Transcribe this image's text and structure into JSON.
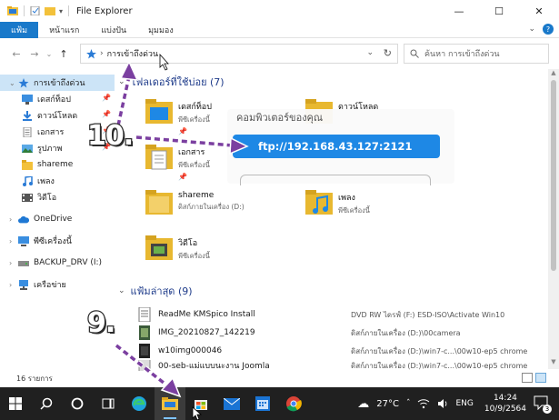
{
  "window": {
    "title": "File Explorer",
    "controls": {
      "minimize": "—",
      "maximize": "☐",
      "close": "✕"
    }
  },
  "ribbon": {
    "tabs": [
      "แฟ้ม",
      "หน้าแรก",
      "แบ่งปัน",
      "มุมมอง"
    ],
    "expand": "⌄",
    "help": "?"
  },
  "address": {
    "back": "←",
    "forward": "→",
    "recent": "⌄",
    "up": "↑",
    "sep": "›",
    "location": "การเข้าถึงด่วน",
    "dropdown": "⌄",
    "refresh": "↻"
  },
  "search": {
    "placeholder": "ค้นหา การเข้าถึงด่วน"
  },
  "sidebar": {
    "quick": "การเข้าถึงด่วน",
    "items": [
      {
        "label": "เดสก์ท็อป",
        "icon": "desktop-icon",
        "pinned": true
      },
      {
        "label": "ดาวน์โหลด",
        "icon": "download-icon",
        "pinned": true
      },
      {
        "label": "เอกสาร",
        "icon": "document-icon",
        "pinned": true
      },
      {
        "label": "รูปภาพ",
        "icon": "picture-icon",
        "pinned": true
      },
      {
        "label": "shareme",
        "icon": "folder-icon",
        "pinned": false
      },
      {
        "label": "เพลง",
        "icon": "music-icon",
        "pinned": false
      },
      {
        "label": "วิดีโอ",
        "icon": "video-icon",
        "pinned": false
      }
    ],
    "onedrive": "OneDrive",
    "thispc": "พีซีเครื่องนี้",
    "drive": "BACKUP_DRV (I:)",
    "network": "เครือข่าย",
    "pin_glyph": "📌"
  },
  "content": {
    "frequent_header": "โฟลเดอร์ที่ใช้บ่อย (7)",
    "frequent": [
      {
        "name": "เดสก์ท็อป",
        "sub": "พีซีเครื่องนี้",
        "pin": "📌",
        "icon": "desktop-folder-icon"
      },
      {
        "name": "ดาวน์โหลด",
        "sub": "",
        "pin": "",
        "icon": "download-folder-icon"
      },
      {
        "name": "เอกสาร",
        "sub": "พีซีเครื่องนี้",
        "pin": "📌",
        "icon": "document-folder-icon"
      },
      {
        "name": "shareme",
        "sub": "ดิสก์ภายในเครื่อง (D:)",
        "pin": "",
        "icon": "folder-icon"
      },
      {
        "name": "เพลง",
        "sub": "พีซีเครื่องนี้",
        "pin": "",
        "icon": "music-folder-icon"
      },
      {
        "name": "วิดีโอ",
        "sub": "พีซีเครื่องนี้",
        "pin": "",
        "icon": "video-folder-icon"
      }
    ],
    "recent_header": "แฟ้มล่าสุด (9)",
    "recent": [
      {
        "name": "ReadMe KMSpico Install",
        "loc": "DVD RW ไดรฟ์ (F:) ESD-ISO\\Activate Win10",
        "icon": "text-file-icon"
      },
      {
        "name": "IMG_20210827_142219",
        "loc": "ดิสก์ภายในเครื่อง (D:)\\00camera",
        "icon": "image-file-icon"
      },
      {
        "name": "w10img000046",
        "loc": "ดิสก์ภายในเครื่อง (D:)\\win7-c...\\00w10-ep5 chrome",
        "icon": "image-file-icon"
      },
      {
        "name": "00-seb-แม่แบบนะงาน Joomla",
        "loc": "ดิสก์ภายในเครื่อง (D:)\\win7-c...\\00w10-ep5 chrome",
        "icon": "image-file-icon"
      }
    ]
  },
  "overlay_card": {
    "title": "คอมพิวเตอร์ของคุณ",
    "ftp": "ftp://192.168.43.127:2121"
  },
  "status": {
    "count": "16 รายการ"
  },
  "annotations": {
    "step10": "10.",
    "step9": "9."
  },
  "taskbar": {
    "start": "⊞",
    "search": "⚲",
    "cortana": "○",
    "taskview": "⧉",
    "weather_icon": "☁",
    "temp": "27°C",
    "tray_up": "ˆ",
    "lang": "ENG",
    "time": "14:24",
    "date": "10/9/2564",
    "notif_count": "3"
  },
  "colors": {
    "accent": "#1979ca",
    "ftp_button": "#1e88e5",
    "arrow": "#7b3fa0",
    "taskbar": "#202020"
  }
}
